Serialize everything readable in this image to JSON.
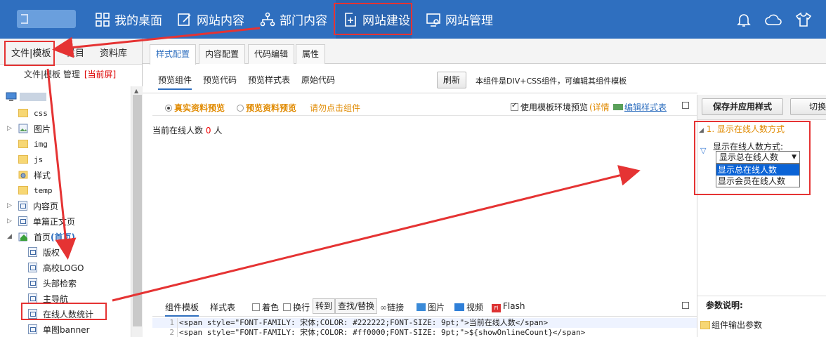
{
  "topnav": {
    "items": [
      {
        "label": "我的桌面",
        "icon": "grid-icon"
      },
      {
        "label": "网站内容",
        "icon": "edit-icon"
      },
      {
        "label": "部门内容",
        "icon": "org-chart-icon"
      },
      {
        "label": "网站建设",
        "icon": "add-page-icon"
      },
      {
        "label": "网站管理",
        "icon": "monitor-settings-icon"
      }
    ],
    "active_index": 3,
    "right_icons": [
      "bell-icon",
      "cloud-icon",
      "shirt-icon"
    ]
  },
  "left": {
    "tabs": [
      "文件|模板",
      "栏目",
      "资料库"
    ],
    "sub_title": "文件|模板 管理",
    "sub_current": "[当前屏]",
    "tree": [
      {
        "label": "css",
        "type": "folder"
      },
      {
        "label": "图片",
        "type": "folder-img"
      },
      {
        "label": "img",
        "type": "folder"
      },
      {
        "label": "js",
        "type": "folder"
      },
      {
        "label": "样式",
        "type": "folder-gear"
      },
      {
        "label": "temp",
        "type": "folder"
      },
      {
        "label": "内容页",
        "type": "page"
      },
      {
        "label": "单篇正文页",
        "type": "page"
      },
      {
        "label": "首页",
        "label_suffix": "(首页)",
        "type": "home"
      },
      {
        "label": "版权",
        "type": "component"
      },
      {
        "label": "高校LOGO",
        "type": "component"
      },
      {
        "label": "头部检索",
        "type": "component"
      },
      {
        "label": "主导航",
        "type": "component"
      },
      {
        "label": "在线人数统计",
        "type": "component"
      },
      {
        "label": "单图banner",
        "type": "component"
      }
    ]
  },
  "main": {
    "tabs": [
      "样式配置",
      "内容配置",
      "代码编辑",
      "属性"
    ],
    "active_tab": 0,
    "subtabs": [
      "预览组件",
      "预览代码",
      "预览样式表",
      "原始代码"
    ],
    "active_subtab": 0,
    "refresh_label": "刷新",
    "info_text": "本组件是DIV+CSS组件，可编辑其组件模板",
    "radio_real": "真实资料预览",
    "radio_preview": "预览资料预览",
    "click_hint": "请勿点击组件",
    "use_env_label": "使用模板环境预览",
    "detail_link": "(详情",
    "edit_stylesheet": "编辑样式表",
    "preview_prefix": "当前在线人数",
    "preview_count": "0",
    "preview_suffix": "人"
  },
  "right": {
    "save_label": "保存并应用样式",
    "switch_label": "切换",
    "prop_title": "1. 显示在线人数方式",
    "field_label": "显示在线人数方式:",
    "selected_value": "显示总在线人数",
    "options": [
      "显示总在线人数",
      "显示会员在线人数"
    ],
    "params_title": "参数说明:",
    "params_item": "组件输出参数"
  },
  "code": {
    "tabs": [
      "组件模板",
      "样式表"
    ],
    "checkbox_color": "着色",
    "checkbox_wrap": "换行",
    "goto_label": "转到",
    "find_label": "查找/替换",
    "link_label": "链接",
    "image_label": "图片",
    "video_label": "视频",
    "flash_label": "Flash",
    "lines": [
      {
        "n": "1",
        "text": "<span style=\"FONT-FAMILY: 宋体;COLOR: #222222;FONT-SIZE: 9pt;\">当前在线人数</span>"
      },
      {
        "n": "2",
        "text": "<span style=\"FONT-FAMILY: 宋体;COLOR: #ff0000;FONT-SIZE: 9pt;\">${showOnlineCount}</span>"
      }
    ]
  },
  "colors": {
    "topbar": "#2f6fbf",
    "annotation": "#e53333",
    "accent": "#2f6fbf"
  }
}
